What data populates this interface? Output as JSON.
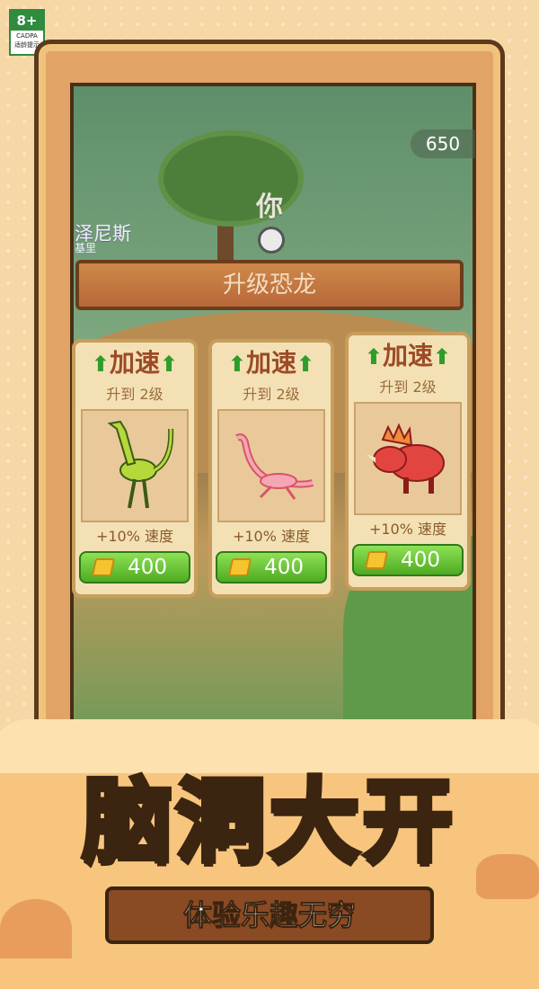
{
  "rating": {
    "age": "8+",
    "org": "CADPA",
    "note": "适龄提示"
  },
  "hud": {
    "score": "650",
    "player_label": "你",
    "npc_name": "泽尼斯",
    "npc_sub": "基里"
  },
  "panel": {
    "title": "升级恐龙"
  },
  "cards": [
    {
      "title": "加速",
      "level": "升到 2级",
      "bonus": "+10% 速度",
      "price": "400",
      "dino": "green-raptor"
    },
    {
      "title": "加速",
      "level": "升到 2级",
      "bonus": "+10% 速度",
      "price": "400",
      "dino": "pink-plesiosaur"
    },
    {
      "title": "加速",
      "level": "升到 2级",
      "bonus": "+10% 速度",
      "price": "400",
      "dino": "red-triceratops"
    }
  ],
  "promo": {
    "headline": "脑洞大开",
    "subline": "体验乐趣无穷"
  },
  "colors": {
    "accent_green": "#4eab22",
    "banner_brown": "#b8683a",
    "card_bg": "#f3e1b5"
  }
}
